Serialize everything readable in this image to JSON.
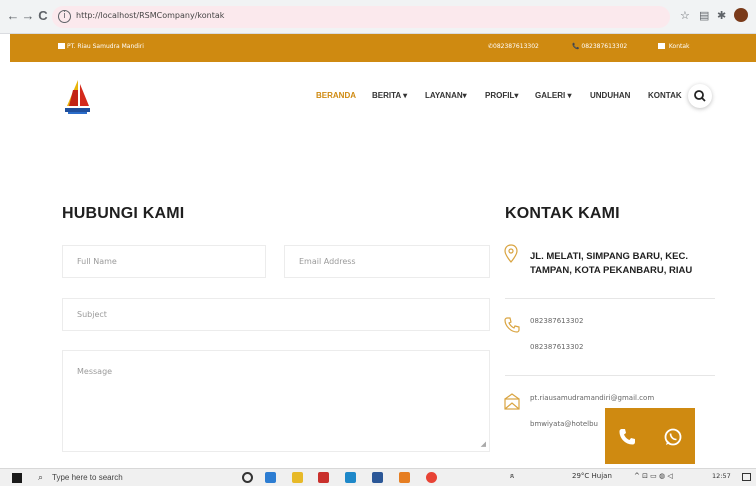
{
  "browser": {
    "back_icon": "arrow-left-icon",
    "url": "http://localhost/RSMCompany/kontak"
  },
  "topbar": {
    "company": "PT. Riau Samudra Mandiri",
    "phone1": "082387613302",
    "phone2": "082387613302",
    "kontak": "Kontak"
  },
  "nav": {
    "items": [
      {
        "label": "BERANDA",
        "active": true
      },
      {
        "label": "BERITA ▾",
        "active": false
      },
      {
        "label": "LAYANAN▾",
        "active": false
      },
      {
        "label": "PROFIL▾",
        "active": false
      },
      {
        "label": "GALERI ▾",
        "active": false
      },
      {
        "label": "UNDUHAN",
        "active": false
      },
      {
        "label": "KONTAK",
        "active": false
      }
    ]
  },
  "form": {
    "title": "HUBUNGI KAMI",
    "fullname_placeholder": "Full Name",
    "email_placeholder": "Email Address",
    "subject_placeholder": "Subject",
    "message_placeholder": "Message"
  },
  "contact": {
    "title": "KONTAK KAMI",
    "address_line1": "JL. MELATI, SIMPANG BARU, KEC.",
    "address_line2": "TAMPAN, KOTA PEKANBARU, RIAU",
    "phone1": "082387613302",
    "phone2": "082387613302",
    "email1": "pt.riausamudramandiri@gmail.com",
    "email2": "bmwiyata@hotelbu"
  },
  "taskbar": {
    "search_placeholder": "Type here to search",
    "weather": "29°C Hujan",
    "time": "12:57"
  },
  "colors": {
    "accent": "#cf8a11"
  }
}
